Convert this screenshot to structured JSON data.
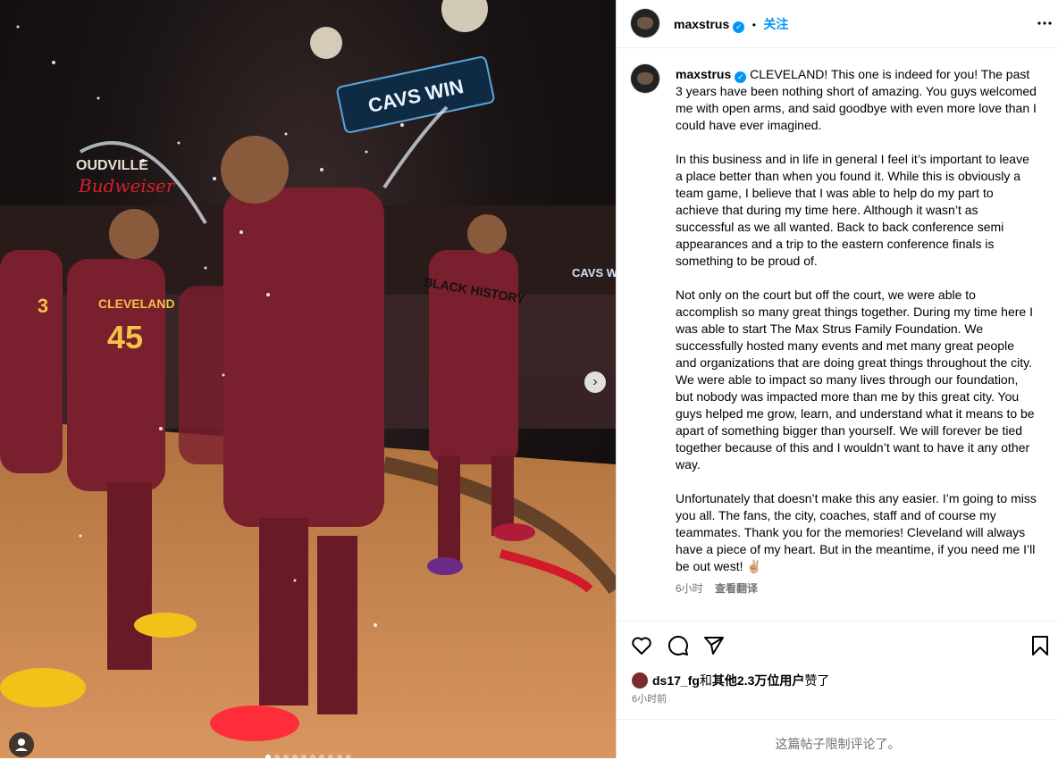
{
  "post": {
    "username": "maxstrus",
    "verified_mark": "✓",
    "dot": "•",
    "follow_label": "关注",
    "more_icon": "more-horizontal-icon",
    "image": {
      "scoreboard_text": "CAVS WIN",
      "sign_text": "CAVS WIN",
      "jersey_number_left": "3",
      "jersey_number_mid": "45",
      "jersey_word": "CLEVELAND",
      "shirt_text": "BLACK HISTORY",
      "arena_text": "OUDVILLE",
      "brand_text": "Budweiser",
      "page_count": 10,
      "current_page": 1
    },
    "caption_paragraphs": [
      "CLEVELAND! This one is indeed for you! The past 3 years have been nothing short of amazing. You guys welcomed me with open arms, and said goodbye with even more love than I could have ever imagined.",
      "In this business and in life in general I feel it’s important to leave a place better than when you found it. While this is obviously a team game, I believe that I was able to help do my part to achieve that during my time here. Although it wasn’t as successful as we all wanted. Back to back conference semi appearances and a trip to the eastern conference finals is something to be proud of.",
      "Not only on the court but off the court, we were able to accomplish so many great things together. During my time here I was able to start The Max Strus Family Foundation. We successfully hosted many events and met many great people and organizations that are doing great things throughout the city. We were able to impact so many lives through our foundation, but nobody was impacted more than me by this great city. You guys helped me grow, learn, and understand what it means to be apart of something bigger than yourself. We will forever be tied together because of this and I wouldn’t want to have it any other way.",
      "Unfortunately that doesn’t make this any easier. I’m going to miss you all. The fans, the city, coaches, staff and of course my teammates. Thank you for the memories! Cleveland will always have a piece of my heart. But in the meantime, if you need me I’ll be out west! ✌🏼"
    ],
    "caption_time": "6小时",
    "translate_label": "查看翻译",
    "likes": {
      "user": "ds17_fg",
      "connector": "和",
      "others": "其他2.3万位用户",
      "suffix": "赞了"
    },
    "post_time": "6小时前",
    "comments_limited": "这篇帖子限制评论了。",
    "action_icons": [
      "heart-icon",
      "comment-icon",
      "share-icon",
      "bookmark-icon"
    ]
  }
}
